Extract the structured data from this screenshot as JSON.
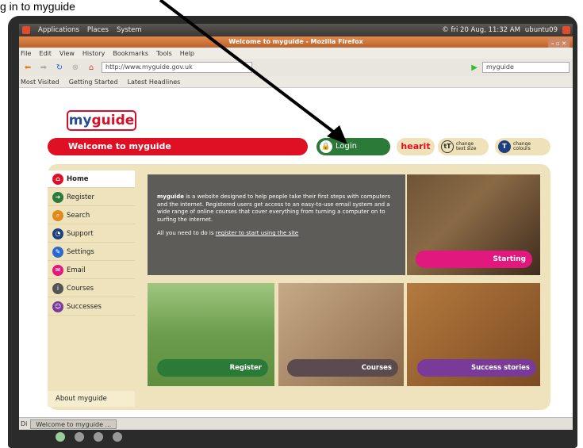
{
  "caption": "g in to myguide",
  "ubuntu_bar": {
    "menus": [
      "Applications",
      "Places",
      "System"
    ],
    "clock": "© fri 20 Aug, 11:32 AM",
    "user": "ubuntu09"
  },
  "window_title": "Welcome to myguide - Mozilla Firefox",
  "menubar": [
    "File",
    "Edit",
    "View",
    "History",
    "Bookmarks",
    "Tools",
    "Help"
  ],
  "navbar": {
    "url": "http://www.myguide.gov.uk",
    "search": "myguide"
  },
  "bookmarks": [
    "Most Visited",
    "Getting Started",
    "Latest Headlines"
  ],
  "site": {
    "logo_my": "my",
    "logo_guide": "guide",
    "welcome": "Welcome to myguide",
    "login": "Login",
    "hearit": "hearit",
    "textsize": [
      "change",
      "text size"
    ],
    "colours": [
      "change",
      "colours"
    ],
    "nav": [
      "Home",
      "Register",
      "Search",
      "Support",
      "Settings",
      "Email",
      "Courses",
      "Successes"
    ],
    "about": "About myguide",
    "intro_bold": "myguide",
    "intro": " is a website designed to help people take their first steps with computers and the internet. Registered users get access to an easy-to-use email system and a wide range of online courses that cover everything from turning a computer on to surfing the internet.",
    "intro2": "All you need to do is ",
    "intro_link": "register to start using the site",
    "starting": "Starting",
    "tiles": [
      "Register",
      "Courses",
      "Success stories"
    ]
  },
  "statusbar": {
    "prefix": "Di",
    "task": "Welcome to myguide ..."
  },
  "colors": {
    "red": "#e01024",
    "green": "#2c7a38",
    "pink": "#e1187d",
    "purple": "#7a3a9a",
    "panel": "#efe3bd"
  }
}
